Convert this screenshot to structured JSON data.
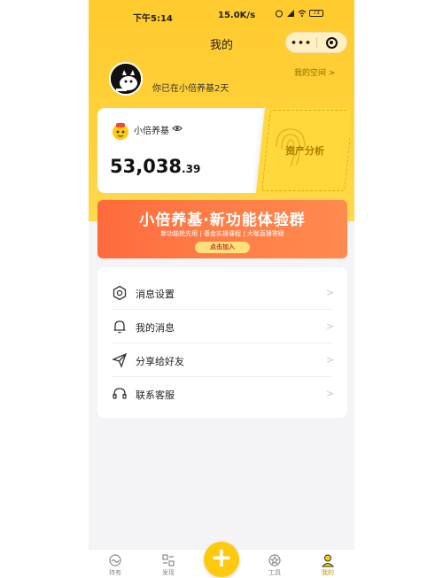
{
  "status": {
    "time": "下午5:14",
    "speed": "15.0K/s",
    "battery": "73"
  },
  "header": {
    "title": "我的",
    "more_label": "•••"
  },
  "profile": {
    "welcome": "你已在小倍养基2天",
    "myspace_label": "我的空间 >"
  },
  "asset": {
    "fund_name": "小倍养基",
    "total_int": "53,038",
    "total_dec": ".39",
    "analysis_label": "资产分析"
  },
  "banner": {
    "title": "小倍养基·新功能体验群",
    "subtitle": "新功能抢先用  |  基金实操课程  |  大咖直播答疑",
    "button": "点击加入"
  },
  "menu": {
    "items": [
      {
        "label": "消息设置",
        "icon": "settings-icon"
      },
      {
        "label": "我的消息",
        "icon": "bell-icon"
      },
      {
        "label": "分享给好友",
        "icon": "send-icon"
      },
      {
        "label": "联系客服",
        "icon": "headset-icon"
      }
    ],
    "chevron": ">"
  },
  "tabbar": {
    "items": [
      {
        "label": "持有",
        "icon": "holdings-icon"
      },
      {
        "label": "发现",
        "icon": "discover-icon"
      },
      {
        "label": "工具",
        "icon": "tools-icon"
      },
      {
        "label": "我的",
        "icon": "profile-icon"
      }
    ],
    "plus_label": "+"
  },
  "colors": {
    "accent": "#ffc90e",
    "banner": "#ff6a3d"
  }
}
